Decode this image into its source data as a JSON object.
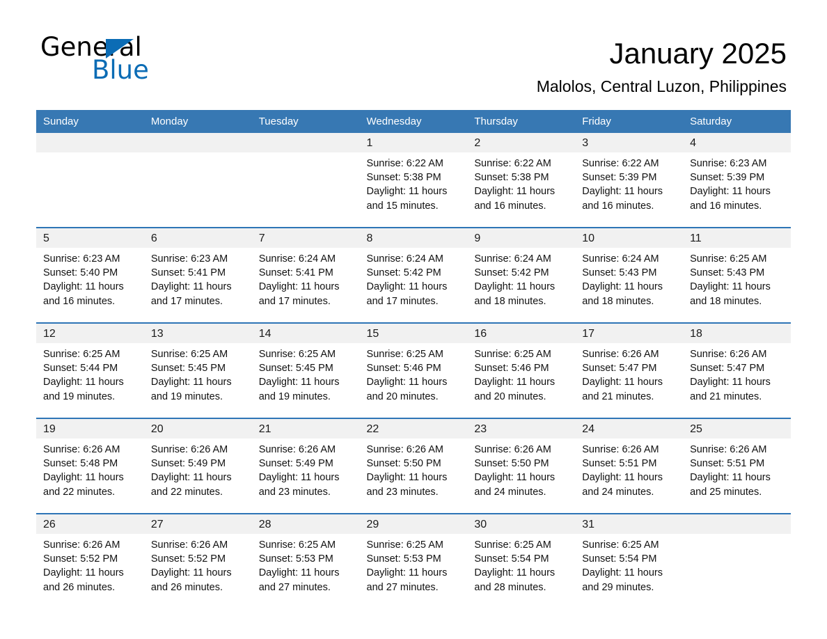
{
  "brand": {
    "name_part1": "General",
    "name_part2": "Blue",
    "flag_icon": "triangle-flag-icon",
    "accent_color": "#0b6cb5"
  },
  "header": {
    "title": "January 2025",
    "location": "Malolos, Central Luzon, Philippines"
  },
  "colors": {
    "header_row": "#3778b3",
    "row_divider": "#2e75b6",
    "daynum_band": "#f1f1f1",
    "page_background": "#ffffff",
    "text": "#000000"
  },
  "calendar": {
    "weekday_headers": [
      "Sunday",
      "Monday",
      "Tuesday",
      "Wednesday",
      "Thursday",
      "Friday",
      "Saturday"
    ],
    "labels": {
      "sunrise_prefix": "Sunrise:",
      "sunset_prefix": "Sunset:",
      "daylight_prefix": "Daylight:"
    },
    "weeks": [
      [
        {
          "day": "",
          "empty": true
        },
        {
          "day": "",
          "empty": true
        },
        {
          "day": "",
          "empty": true
        },
        {
          "day": "1",
          "sunrise": "Sunrise: 6:22 AM",
          "sunset": "Sunset: 5:38 PM",
          "daylight": "Daylight: 11 hours and 15 minutes."
        },
        {
          "day": "2",
          "sunrise": "Sunrise: 6:22 AM",
          "sunset": "Sunset: 5:38 PM",
          "daylight": "Daylight: 11 hours and 16 minutes."
        },
        {
          "day": "3",
          "sunrise": "Sunrise: 6:22 AM",
          "sunset": "Sunset: 5:39 PM",
          "daylight": "Daylight: 11 hours and 16 minutes."
        },
        {
          "day": "4",
          "sunrise": "Sunrise: 6:23 AM",
          "sunset": "Sunset: 5:39 PM",
          "daylight": "Daylight: 11 hours and 16 minutes."
        }
      ],
      [
        {
          "day": "5",
          "sunrise": "Sunrise: 6:23 AM",
          "sunset": "Sunset: 5:40 PM",
          "daylight": "Daylight: 11 hours and 16 minutes."
        },
        {
          "day": "6",
          "sunrise": "Sunrise: 6:23 AM",
          "sunset": "Sunset: 5:41 PM",
          "daylight": "Daylight: 11 hours and 17 minutes."
        },
        {
          "day": "7",
          "sunrise": "Sunrise: 6:24 AM",
          "sunset": "Sunset: 5:41 PM",
          "daylight": "Daylight: 11 hours and 17 minutes."
        },
        {
          "day": "8",
          "sunrise": "Sunrise: 6:24 AM",
          "sunset": "Sunset: 5:42 PM",
          "daylight": "Daylight: 11 hours and 17 minutes."
        },
        {
          "day": "9",
          "sunrise": "Sunrise: 6:24 AM",
          "sunset": "Sunset: 5:42 PM",
          "daylight": "Daylight: 11 hours and 18 minutes."
        },
        {
          "day": "10",
          "sunrise": "Sunrise: 6:24 AM",
          "sunset": "Sunset: 5:43 PM",
          "daylight": "Daylight: 11 hours and 18 minutes."
        },
        {
          "day": "11",
          "sunrise": "Sunrise: 6:25 AM",
          "sunset": "Sunset: 5:43 PM",
          "daylight": "Daylight: 11 hours and 18 minutes."
        }
      ],
      [
        {
          "day": "12",
          "sunrise": "Sunrise: 6:25 AM",
          "sunset": "Sunset: 5:44 PM",
          "daylight": "Daylight: 11 hours and 19 minutes."
        },
        {
          "day": "13",
          "sunrise": "Sunrise: 6:25 AM",
          "sunset": "Sunset: 5:45 PM",
          "daylight": "Daylight: 11 hours and 19 minutes."
        },
        {
          "day": "14",
          "sunrise": "Sunrise: 6:25 AM",
          "sunset": "Sunset: 5:45 PM",
          "daylight": "Daylight: 11 hours and 19 minutes."
        },
        {
          "day": "15",
          "sunrise": "Sunrise: 6:25 AM",
          "sunset": "Sunset: 5:46 PM",
          "daylight": "Daylight: 11 hours and 20 minutes."
        },
        {
          "day": "16",
          "sunrise": "Sunrise: 6:25 AM",
          "sunset": "Sunset: 5:46 PM",
          "daylight": "Daylight: 11 hours and 20 minutes."
        },
        {
          "day": "17",
          "sunrise": "Sunrise: 6:26 AM",
          "sunset": "Sunset: 5:47 PM",
          "daylight": "Daylight: 11 hours and 21 minutes."
        },
        {
          "day": "18",
          "sunrise": "Sunrise: 6:26 AM",
          "sunset": "Sunset: 5:47 PM",
          "daylight": "Daylight: 11 hours and 21 minutes."
        }
      ],
      [
        {
          "day": "19",
          "sunrise": "Sunrise: 6:26 AM",
          "sunset": "Sunset: 5:48 PM",
          "daylight": "Daylight: 11 hours and 22 minutes."
        },
        {
          "day": "20",
          "sunrise": "Sunrise: 6:26 AM",
          "sunset": "Sunset: 5:49 PM",
          "daylight": "Daylight: 11 hours and 22 minutes."
        },
        {
          "day": "21",
          "sunrise": "Sunrise: 6:26 AM",
          "sunset": "Sunset: 5:49 PM",
          "daylight": "Daylight: 11 hours and 23 minutes."
        },
        {
          "day": "22",
          "sunrise": "Sunrise: 6:26 AM",
          "sunset": "Sunset: 5:50 PM",
          "daylight": "Daylight: 11 hours and 23 minutes."
        },
        {
          "day": "23",
          "sunrise": "Sunrise: 6:26 AM",
          "sunset": "Sunset: 5:50 PM",
          "daylight": "Daylight: 11 hours and 24 minutes."
        },
        {
          "day": "24",
          "sunrise": "Sunrise: 6:26 AM",
          "sunset": "Sunset: 5:51 PM",
          "daylight": "Daylight: 11 hours and 24 minutes."
        },
        {
          "day": "25",
          "sunrise": "Sunrise: 6:26 AM",
          "sunset": "Sunset: 5:51 PM",
          "daylight": "Daylight: 11 hours and 25 minutes."
        }
      ],
      [
        {
          "day": "26",
          "sunrise": "Sunrise: 6:26 AM",
          "sunset": "Sunset: 5:52 PM",
          "daylight": "Daylight: 11 hours and 26 minutes."
        },
        {
          "day": "27",
          "sunrise": "Sunrise: 6:26 AM",
          "sunset": "Sunset: 5:52 PM",
          "daylight": "Daylight: 11 hours and 26 minutes."
        },
        {
          "day": "28",
          "sunrise": "Sunrise: 6:25 AM",
          "sunset": "Sunset: 5:53 PM",
          "daylight": "Daylight: 11 hours and 27 minutes."
        },
        {
          "day": "29",
          "sunrise": "Sunrise: 6:25 AM",
          "sunset": "Sunset: 5:53 PM",
          "daylight": "Daylight: 11 hours and 27 minutes."
        },
        {
          "day": "30",
          "sunrise": "Sunrise: 6:25 AM",
          "sunset": "Sunset: 5:54 PM",
          "daylight": "Daylight: 11 hours and 28 minutes."
        },
        {
          "day": "31",
          "sunrise": "Sunrise: 6:25 AM",
          "sunset": "Sunset: 5:54 PM",
          "daylight": "Daylight: 11 hours and 29 minutes."
        },
        {
          "day": "",
          "empty": true
        }
      ]
    ]
  }
}
